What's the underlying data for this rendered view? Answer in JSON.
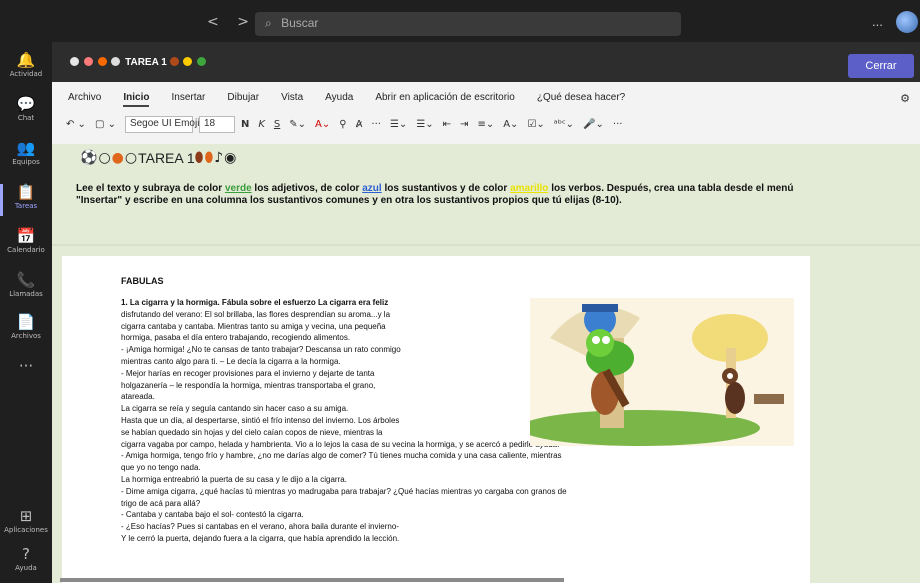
{
  "topbar": {
    "back": "<",
    "forward": ">",
    "search_placeholder": "Buscar",
    "more": "..."
  },
  "rail": [
    {
      "icon": "bell-icon",
      "glyph": "🔔",
      "label": "Actividad"
    },
    {
      "icon": "chat-icon",
      "glyph": "💬",
      "label": "Chat"
    },
    {
      "icon": "teams-icon",
      "glyph": "👥",
      "label": "Equipos"
    },
    {
      "icon": "assignments-icon",
      "glyph": "📋",
      "label": "Tareas",
      "active": true
    },
    {
      "icon": "calendar-icon",
      "glyph": "📅",
      "label": "Calendario"
    },
    {
      "icon": "phone-icon",
      "glyph": "📞",
      "label": "Llamadas"
    },
    {
      "icon": "files-icon",
      "glyph": "📄",
      "label": "Archivos"
    },
    {
      "icon": "more-icon",
      "glyph": "···",
      "label": ""
    },
    {
      "icon": "apps-icon",
      "glyph": "⊞",
      "label": "Aplicaciones"
    },
    {
      "icon": "help-icon",
      "glyph": "?",
      "label": "Ayuda"
    }
  ],
  "header": {
    "title": "TAREA 1",
    "close_label": "Cerrar"
  },
  "ribbon": {
    "tabs": [
      "Archivo",
      "Inicio",
      "Insertar",
      "Dibujar",
      "Vista",
      "Ayuda",
      "Abrir en aplicación de escritorio"
    ],
    "active_tab": "Inicio",
    "tell_me": "¿Qué desea hacer?",
    "font": "Segoe UI Emoji",
    "size": "18",
    "bold": "N",
    "italic": "K",
    "underline": "S"
  },
  "doc": {
    "heading": "TAREA 1",
    "instr": {
      "p1": "Lee el texto y subraya de color ",
      "green": "verde",
      "p2": " los adjetivos, de color ",
      "blue": "azul",
      "p3": " los sustantivos y de color ",
      "yellow": "amarillo",
      "p4": " los verbos. Después, crea una tabla desde el menú \"Insertar\" y escribe en una columna los sustantivos comunes y en otra los sustantivos propios que tú elijas (8-10)."
    },
    "page_title": "FABULAS",
    "lines": [
      "1. La cigarra y la hormiga. Fábula sobre el esfuerzo La cigarra era feliz",
      "disfrutando del verano: El sol brillaba, las flores desprendían su aroma...y la",
      "cigarra cantaba y cantaba. Mientras tanto su amiga y vecina, una pequeña",
      "hormiga, pasaba el día entero trabajando, recogiendo alimentos.",
      "- ¡Amiga hormiga! ¿No te cansas de tanto trabajar? Descansa un rato conmigo",
      "mientras canto algo para ti. – Le decía la cigarra a la hormiga.",
      "- Mejor harías en recoger provisiones para el invierno y dejarte de tanta",
      "holgazanería – le respondía la hormiga, mientras transportaba el grano,",
      "atareada.",
      "La cigarra se reía y seguía cantando sin hacer caso a su amiga.",
      "Hasta que un día, al despertarse, sintió el frío intenso del invierno. Los árboles",
      "se habían quedado sin hojas y del cielo caían copos de nieve, mientras la",
      "cigarra vagaba por campo, helada y hambrienta. Vio a lo lejos la casa de su vecina la hormiga, y se acercó a pedirle ayuda.",
      "- Amiga hormiga, tengo frío y hambre, ¿no me darías algo de comer? Tú tienes mucha comida y una casa caliente, mientras",
      "que yo no tengo nada.",
      "La hormiga entreabrió la puerta de su casa y le dijo a la cigarra.",
      "- Dime amiga cigarra, ¿qué hacías tú mientras yo madrugaba para trabajar? ¿Qué hacías mientras yo cargaba con granos de",
      "trigo de acá para allá?",
      "- Cantaba y cantaba bajo el sol- contestó la cigarra.",
      "- ¿Eso hacías? Pues si cantabas en el verano, ahora baila durante el invierno-",
      "Y le cerró la puerta, dejando fuera a la cigarra, que había aprendido la lección."
    ]
  }
}
